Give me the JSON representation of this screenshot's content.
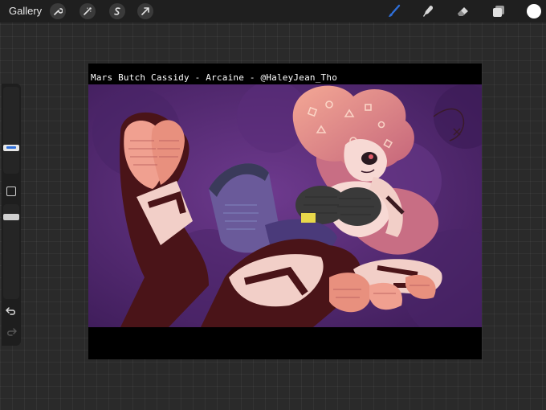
{
  "topbar": {
    "gallery_label": "Gallery",
    "left_tools": [
      "wrench-icon",
      "magic-wand-icon",
      "selection-s-icon",
      "transform-arrow-icon"
    ],
    "right_tools": [
      "brush-icon",
      "smudge-icon",
      "eraser-icon",
      "layers-icon"
    ],
    "active_tool": "brush-icon",
    "active_color": "#ffffff",
    "accent_color": "#2f6fd8"
  },
  "canvas": {
    "caption": "Mars Butch Cassidy - Arcaine - @HaleyJean_Tho"
  },
  "sidebar": {
    "brush_size_level": 0.45,
    "opacity_level": 1.0
  },
  "colors": {
    "background": "#2a2a2a",
    "art_purple": "#5a2a7a",
    "art_pink": "#f0a090",
    "art_maroon": "#4a1418"
  }
}
